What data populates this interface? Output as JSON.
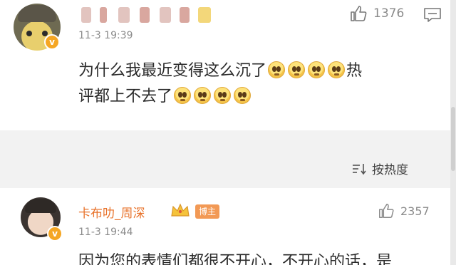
{
  "comments": [
    {
      "time": "11-3 19:39",
      "likes": "1376",
      "text_line1": "为什么我最近变得这么沉了",
      "text_line1_tail": "热",
      "text_line2": "评都上不去了"
    },
    {
      "username": "卡布叻_周深",
      "role_badge": "博主",
      "time": "11-3 19:44",
      "likes": "2357",
      "text": "因为您的表情们都很不开心，不开心的话，是"
    }
  ],
  "sort": {
    "label": "按热度"
  },
  "colors": {
    "username": "#e8722a",
    "role_badge": "#f29955",
    "verified": "#f5a623"
  }
}
